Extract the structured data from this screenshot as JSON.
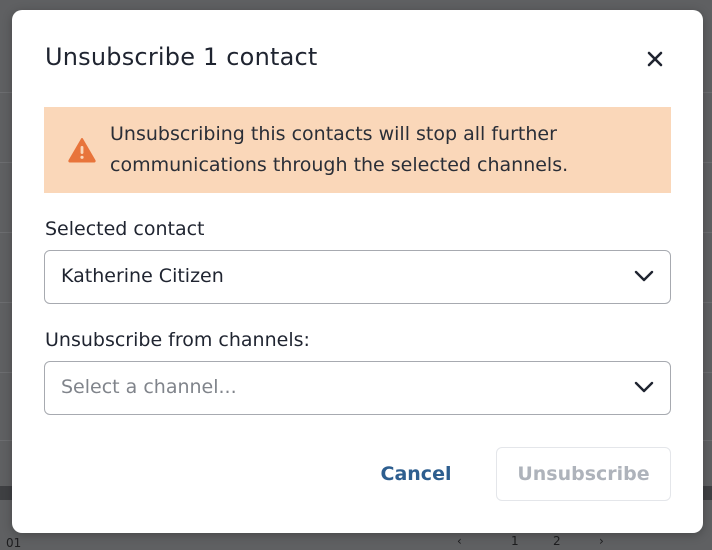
{
  "background": {
    "footer_number": "01",
    "pager": {
      "prev": "‹",
      "current": "1",
      "next_page": "2",
      "next": "›"
    }
  },
  "modal": {
    "title": "Unsubscribe 1 contact",
    "close_icon": "close-icon",
    "alert": {
      "icon": "warning-icon",
      "text": "Unsubscribing this contacts will stop all further communications through the selected channels.",
      "background": "#fad7b9",
      "icon_color": "#e8743b"
    },
    "contact_field": {
      "label": "Selected contact",
      "value": "Katherine Citizen"
    },
    "channels_field": {
      "label": "Unsubscribe from channels:",
      "placeholder": "Select a channel..."
    },
    "buttons": {
      "cancel": "Cancel",
      "unsubscribe": "Unsubscribe"
    }
  },
  "colors": {
    "accent": "#2d5e8f",
    "disabled_text": "#aeb3bb"
  }
}
